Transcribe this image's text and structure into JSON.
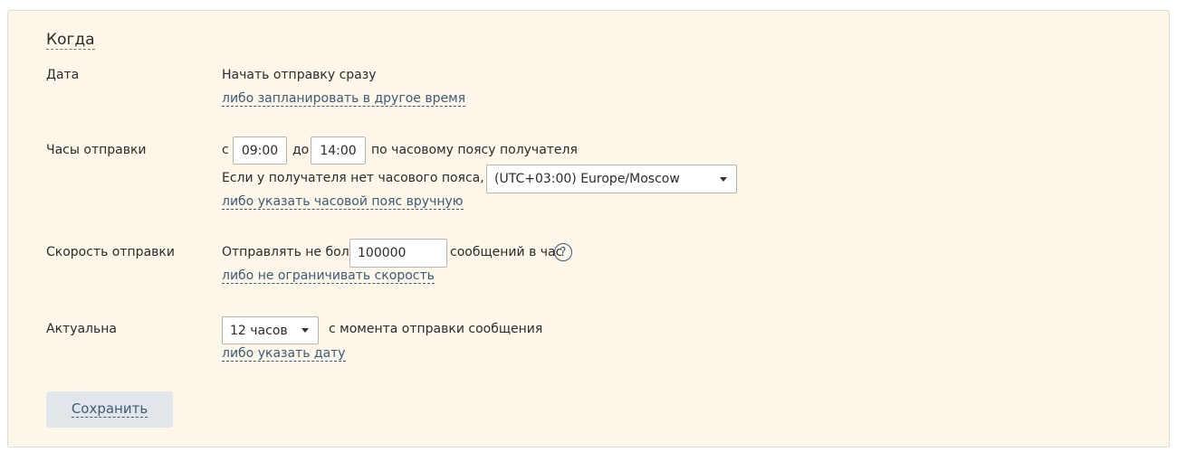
{
  "section": {
    "title": "Когда"
  },
  "date": {
    "label": "Дата",
    "value": "Начать отправку сразу",
    "link": "либо запланировать в другое время"
  },
  "hours": {
    "label": "Часы отправки",
    "from_prefix": "с",
    "from_value": "09:00",
    "to_prefix": "до",
    "to_value": "14:00",
    "suffix": "по часовому поясу получателя",
    "fallback_text": "Если у получателя нет часового пояса, то по",
    "timezone_selected": "(UTC+03:00) Europe/Moscow",
    "link": "либо указать часовой пояс вручную"
  },
  "speed": {
    "label": "Скорость отправки",
    "prefix": "Отправлять не более",
    "value": "100000",
    "suffix": "сообщений в час",
    "help_symbol": "?",
    "link": "либо не ограничивать скорость"
  },
  "relevance": {
    "label": "Актуальна",
    "selected": "12 часов",
    "suffix": "с момента отправки сообщения",
    "link": "либо указать дату"
  },
  "actions": {
    "save_label": "Сохранить"
  },
  "colors": {
    "panel_background": "#fcf7e9",
    "link": "#3d5a78",
    "button_background": "#e1e6ea"
  },
  "icons": {
    "help": "question-circle-icon",
    "dropdown": "caret-down-icon"
  }
}
